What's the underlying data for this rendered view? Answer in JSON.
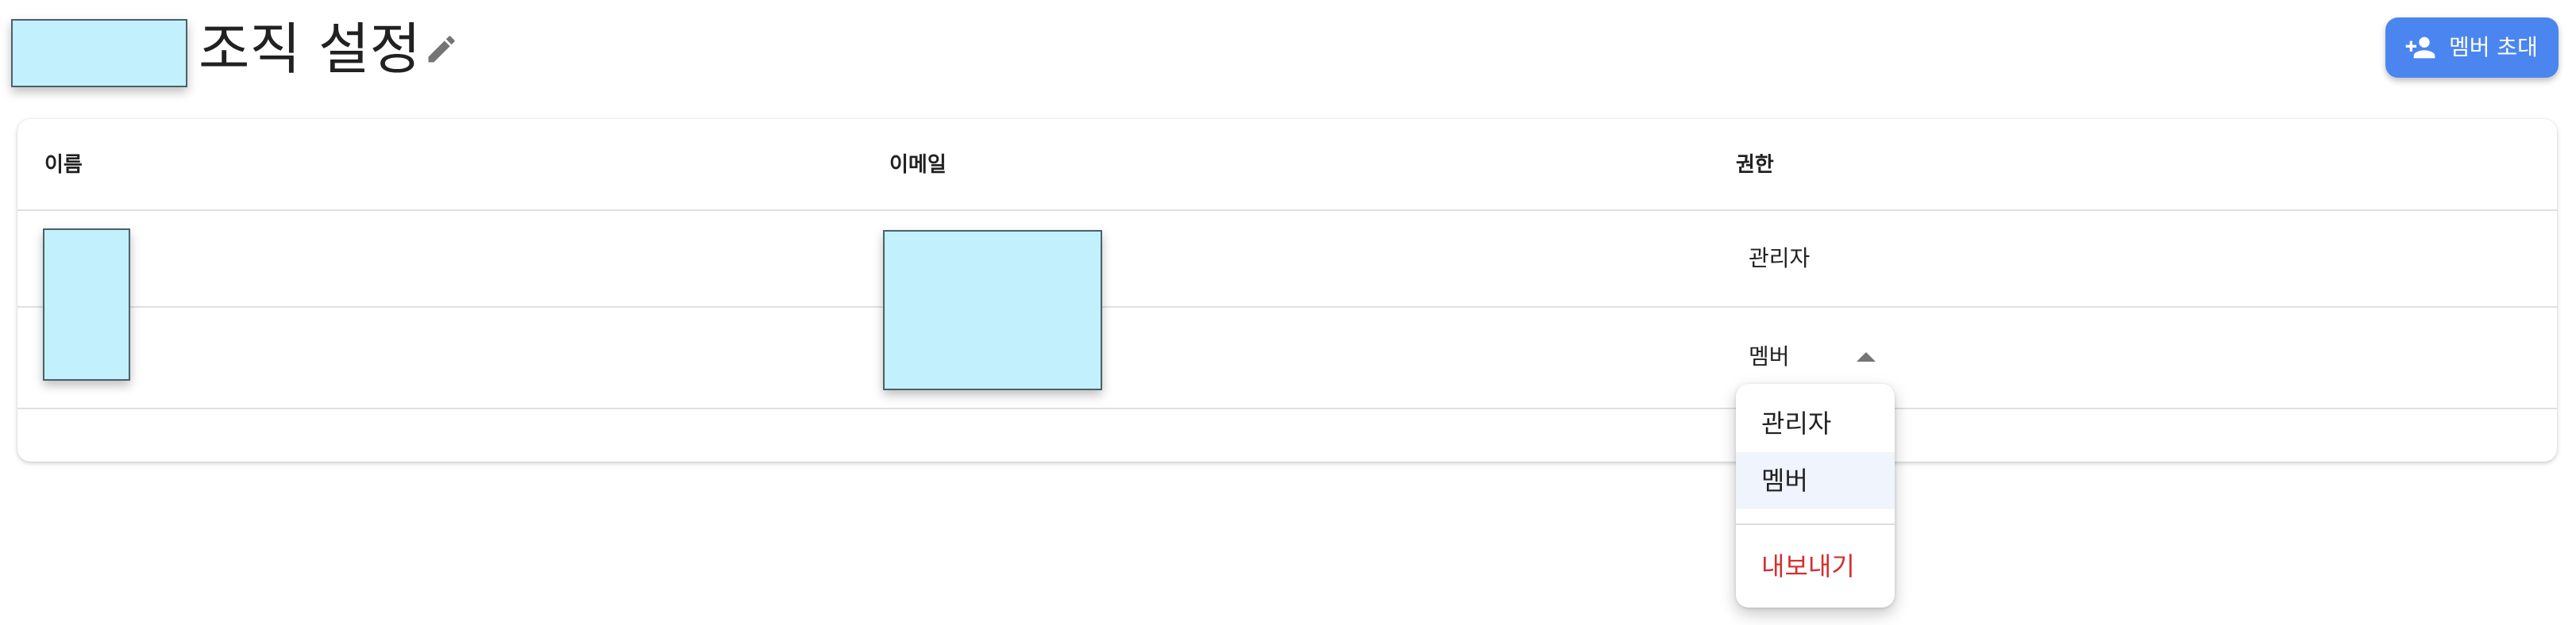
{
  "header": {
    "title": "조직 설정",
    "edit_icon": "pencil-icon",
    "invite_button": {
      "label": "멤버 초대",
      "icon": "person-add-icon",
      "color": "#4b86f0"
    }
  },
  "table": {
    "columns": [
      "이름",
      "이메일",
      "권한"
    ],
    "rows": [
      {
        "role": "관리자"
      },
      {
        "role": "멤버",
        "role_dropdown_open": true
      }
    ]
  },
  "role_menu": {
    "items": [
      {
        "label": "관리자"
      },
      {
        "label": "멤버",
        "selected": true
      },
      {
        "label": "내보내기",
        "danger": true,
        "color": "#d32f2f"
      }
    ]
  }
}
